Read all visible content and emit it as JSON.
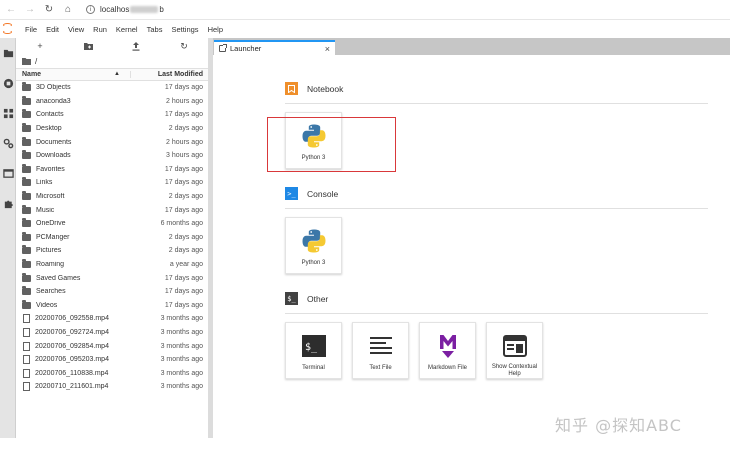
{
  "browser": {
    "address_prefix": "localhos",
    "address_suffix": "b"
  },
  "menu": [
    "File",
    "Edit",
    "View",
    "Run",
    "Kernel",
    "Tabs",
    "Settings",
    "Help"
  ],
  "file_browser": {
    "breadcrumb": "/",
    "header_name": "Name",
    "header_modified": "Last Modified",
    "items": [
      {
        "name": "3D Objects",
        "modified": "17 days ago",
        "type": "folder"
      },
      {
        "name": "anaconda3",
        "modified": "2 hours ago",
        "type": "folder"
      },
      {
        "name": "Contacts",
        "modified": "17 days ago",
        "type": "folder"
      },
      {
        "name": "Desktop",
        "modified": "2 days ago",
        "type": "folder"
      },
      {
        "name": "Documents",
        "modified": "2 hours ago",
        "type": "folder"
      },
      {
        "name": "Downloads",
        "modified": "3 hours ago",
        "type": "folder"
      },
      {
        "name": "Favorites",
        "modified": "17 days ago",
        "type": "folder"
      },
      {
        "name": "Links",
        "modified": "17 days ago",
        "type": "folder"
      },
      {
        "name": "Microsoft",
        "modified": "2 days ago",
        "type": "folder"
      },
      {
        "name": "Music",
        "modified": "17 days ago",
        "type": "folder"
      },
      {
        "name": "OneDrive",
        "modified": "6 months ago",
        "type": "folder"
      },
      {
        "name": "PCManger",
        "modified": "2 days ago",
        "type": "folder"
      },
      {
        "name": "Pictures",
        "modified": "2 days ago",
        "type": "folder"
      },
      {
        "name": "Roaming",
        "modified": "a year ago",
        "type": "folder"
      },
      {
        "name": "Saved Games",
        "modified": "17 days ago",
        "type": "folder"
      },
      {
        "name": "Searches",
        "modified": "17 days ago",
        "type": "folder"
      },
      {
        "name": "Videos",
        "modified": "17 days ago",
        "type": "folder"
      },
      {
        "name": "20200706_092558.mp4",
        "modified": "3 months ago",
        "type": "file"
      },
      {
        "name": "20200706_092724.mp4",
        "modified": "3 months ago",
        "type": "file"
      },
      {
        "name": "20200706_092854.mp4",
        "modified": "3 months ago",
        "type": "file"
      },
      {
        "name": "20200706_095203.mp4",
        "modified": "3 months ago",
        "type": "file"
      },
      {
        "name": "20200706_110838.mp4",
        "modified": "3 months ago",
        "type": "file"
      },
      {
        "name": "20200710_211601.mp4",
        "modified": "3 months ago",
        "type": "file"
      }
    ]
  },
  "tab": {
    "label": "Launcher",
    "close": "×"
  },
  "launcher": {
    "notebook": {
      "title": "Notebook",
      "cards": [
        "Python 3"
      ]
    },
    "console": {
      "title": "Console",
      "cards": [
        "Python 3"
      ]
    },
    "other": {
      "title": "Other",
      "cards": [
        "Terminal",
        "Text File",
        "Markdown File",
        "Show Contextual Help"
      ]
    }
  },
  "watermark": "知乎 @探知ABC",
  "colors": {
    "accent": "#2196f3",
    "jupyter_orange": "#f37726",
    "notebook_icon": "#ef8f2b",
    "console_icon": "#1e88e5",
    "other_icon": "#424242",
    "markdown_purple": "#7b1fa2",
    "highlight": "#d9383a"
  }
}
